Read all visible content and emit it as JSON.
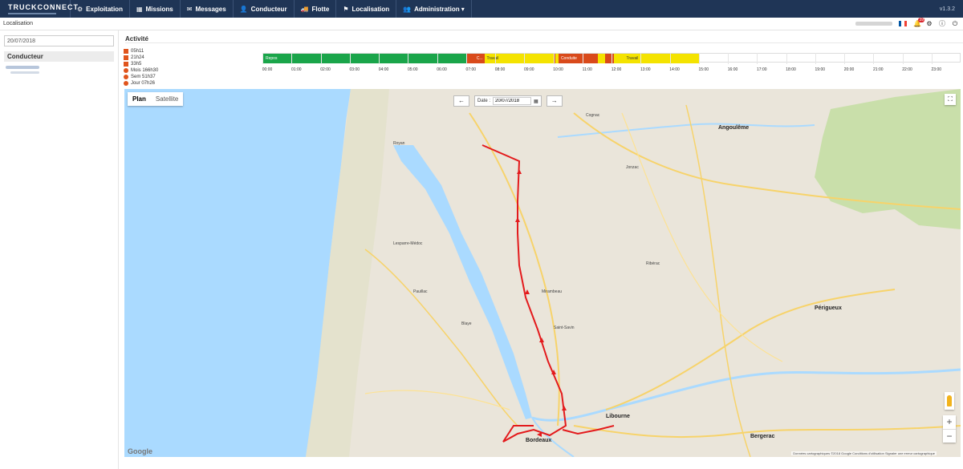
{
  "brand": {
    "name": "TRUCKCONNECT"
  },
  "nav": {
    "items": [
      {
        "label": "Exploitation",
        "icon": "gear-icon",
        "glyph": "⚙"
      },
      {
        "label": "Missions",
        "icon": "grid-icon",
        "glyph": "▦"
      },
      {
        "label": "Messages",
        "icon": "chat-icon",
        "glyph": "✉"
      },
      {
        "label": "Conducteur",
        "icon": "user-icon",
        "glyph": "👤"
      },
      {
        "label": "Flotte",
        "icon": "truck-icon",
        "glyph": "🚚"
      },
      {
        "label": "Localisation",
        "icon": "flag-icon",
        "glyph": "⚑"
      },
      {
        "label": "Administration ▾",
        "icon": "users-icon",
        "glyph": "👥"
      }
    ],
    "version": "v1.3.2"
  },
  "breadcrumb": "Localisation",
  "toolbar": {
    "notification_count": "39",
    "flag_colors": [
      "#0055a4",
      "#ffffff",
      "#ef4135"
    ]
  },
  "left": {
    "search_value": "20/07/2018",
    "conducteur_header": "Conducteur"
  },
  "activity": {
    "title": "Activité",
    "legend": [
      {
        "shape": "sq",
        "text": "05h11"
      },
      {
        "shape": "sq",
        "text": "21h24"
      },
      {
        "shape": "sq",
        "text": "33h5"
      },
      {
        "shape": "dot",
        "text": "Mois 166h30"
      },
      {
        "shape": "dot",
        "text": "Sem 51h37"
      },
      {
        "shape": "dot",
        "text": "Jour 07h26"
      }
    ],
    "segments": [
      {
        "label": "Repos",
        "color": "#1aa54a",
        "start": 0.0,
        "end": 7.0
      },
      {
        "label": "",
        "color": "#d94a1b",
        "start": 7.0,
        "end": 7.25
      },
      {
        "label": "C...",
        "color": "#d94a1b",
        "start": 7.25,
        "end": 7.6
      },
      {
        "label": "Travail",
        "color": "#f4e300",
        "start": 7.6,
        "end": 10.0
      },
      {
        "label": "",
        "color": "#d94a1b",
        "start": 10.0,
        "end": 10.05
      },
      {
        "label": "",
        "color": "#f4e300",
        "start": 10.05,
        "end": 10.15
      },
      {
        "label": "Conduite",
        "color": "#d94a1b",
        "start": 10.15,
        "end": 11.5
      },
      {
        "label": "",
        "color": "#f4e300",
        "start": 11.5,
        "end": 11.75
      },
      {
        "label": "",
        "color": "#d94a1b",
        "start": 11.75,
        "end": 12.05
      },
      {
        "label": "",
        "color": "#f4e300",
        "start": 12.05,
        "end": 12.4
      },
      {
        "label": "Travail",
        "color": "#f4e300",
        "start": 12.4,
        "end": 15.0
      }
    ],
    "ticks": [
      "00:00",
      "01:00",
      "02:00",
      "03:00",
      "04:00",
      "05:00",
      "06:00",
      "07:00",
      "08:00",
      "09:00",
      "10:00",
      "11:00",
      "12:00",
      "13:00",
      "14:00",
      "15:00",
      "16:00",
      "17:00",
      "18:00",
      "19:00",
      "20:00",
      "21:00",
      "22:00",
      "23:00"
    ]
  },
  "map": {
    "tab_plan": "Plan",
    "tab_satellite": "Satellite",
    "date_label": "Date :",
    "date_value": "20/07/2018",
    "prev": "←",
    "next": "→",
    "google": "Google",
    "footer": "Données cartographiques ©2018 Google  Conditions d'utilisation  Signaler une erreur cartographique",
    "towns": [
      {
        "name": "Saintes",
        "big": false
      },
      {
        "name": "Cognac",
        "big": false
      },
      {
        "name": "Angoulême",
        "big": true
      },
      {
        "name": "Jonzac",
        "big": false
      },
      {
        "name": "Libourne",
        "big": true
      },
      {
        "name": "Bordeaux",
        "big": true
      },
      {
        "name": "Périgueux",
        "big": true
      },
      {
        "name": "Bergerac",
        "big": true
      },
      {
        "name": "Lesparre-Médoc",
        "big": false
      },
      {
        "name": "Royan",
        "big": false
      },
      {
        "name": "Blaye",
        "big": false
      },
      {
        "name": "Pauillac",
        "big": false
      },
      {
        "name": "Saint-Savin",
        "big": false
      },
      {
        "name": "Mirambeau",
        "big": false
      },
      {
        "name": "Ribérac",
        "big": false
      }
    ]
  }
}
